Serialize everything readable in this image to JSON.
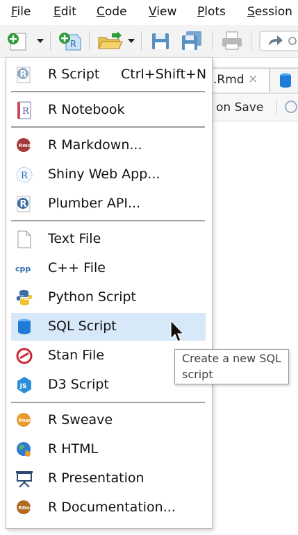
{
  "menubar": {
    "items": [
      {
        "label": "File",
        "accel": "F"
      },
      {
        "label": "Edit",
        "accel": "E"
      },
      {
        "label": "Code",
        "accel": "C"
      },
      {
        "label": "View",
        "accel": "V"
      },
      {
        "label": "Plots",
        "accel": "P"
      },
      {
        "label": "Session",
        "accel": "S"
      }
    ]
  },
  "toolbar": {
    "icons": [
      "new-file-icon",
      "new-project-icon",
      "open-file-icon",
      "save-icon",
      "save-all-icon",
      "print-icon",
      "go-to-file-icon"
    ]
  },
  "editor": {
    "tab_label": ".Rmd",
    "tab_close": "×",
    "save_label": "on Save"
  },
  "menu": {
    "items": [
      {
        "label": "R Script",
        "shortcut": "Ctrl+Shift+N",
        "icon": "r-script-icon"
      },
      {
        "label": "R Notebook",
        "icon": "r-notebook-icon"
      },
      {
        "label": "R Markdown...",
        "icon": "r-markdown-icon"
      },
      {
        "label": "Shiny Web App...",
        "icon": "shiny-icon"
      },
      {
        "label": "Plumber API...",
        "icon": "plumber-icon"
      },
      {
        "label": "Text File",
        "icon": "text-file-icon"
      },
      {
        "label": "C++ File",
        "icon": "cpp-icon"
      },
      {
        "label": "Python Script",
        "icon": "python-icon"
      },
      {
        "label": "SQL Script",
        "icon": "sql-icon",
        "highlighted": true
      },
      {
        "label": "Stan File",
        "icon": "stan-icon"
      },
      {
        "label": "D3 Script",
        "icon": "d3-icon"
      },
      {
        "label": "R Sweave",
        "icon": "sweave-icon"
      },
      {
        "label": "R HTML",
        "icon": "r-html-icon"
      },
      {
        "label": "R Presentation",
        "icon": "presentation-icon"
      },
      {
        "label": "R Documentation...",
        "icon": "r-doc-icon"
      }
    ]
  },
  "tooltip": {
    "line1": "Create a new SQL",
    "line2": "script"
  },
  "colors": {
    "highlight": "#d7e8f8",
    "accent_green": "#2e9a3a",
    "accent_blue": "#1f7bd8"
  }
}
